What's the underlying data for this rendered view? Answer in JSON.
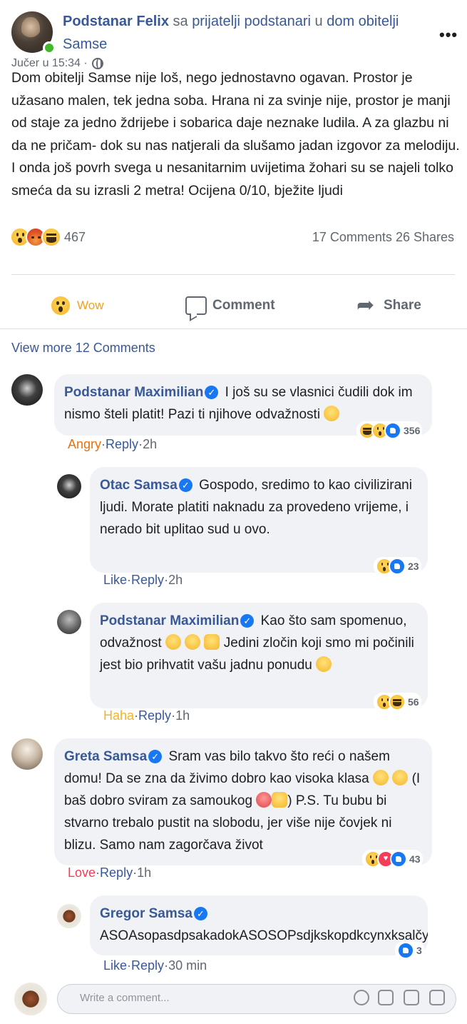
{
  "post": {
    "author": "Podstanar Felix",
    "with_text": "sa",
    "group": "prijatelji podstanari",
    "in_text": "u",
    "place": "dom obitelji Samse",
    "timestamp": "Jučer u 15:34 ·",
    "body": "Dom obitelji Samse nije loš, nego jednostavno ogavan. Prostor je užasano malen, tek jedna soba. Hrana ni za svinje nije, prostor je manji od staje za jedno ždrijebe i sobarica daje neznake ludila. A za glazbu ni da ne pričam- dok su nas natjerali da slušamo jadan izgovor za melodiju. I onda još povrh svega u nesanitarnim uvijetima žohari su se najeli tolko smeća da su izrasli 2 metra! Ocijena 0/10, bježite ljudi",
    "reaction_count": "467",
    "comments_count": "17 Comments",
    "shares_count": "26 Shares"
  },
  "actions": {
    "wow_label": "Wow",
    "comment_label": "Comment",
    "share_label": "Share"
  },
  "view_more": "View more 12 Comments",
  "comments": [
    {
      "name": "Podstanar Maximilian",
      "text": "I još su se vlasnici čudili dok im nismo šteli platit! Pazi ti njihove odvažnosti",
      "reaction": "Angry",
      "reply": "Reply",
      "time": "2h",
      "count": "356"
    },
    {
      "name": "Otac Samsa",
      "text": "Gospodo, sredimo to kao civilizirani ljudi. Morate platiti naknadu za provedeno vrijeme, i nerado bit uplitao sud u ovo.",
      "reaction": "Like",
      "reply": "Reply",
      "time": "2h",
      "count": "23"
    },
    {
      "name": "Podstanar Maximilian",
      "text": "Kao što sam spomenuo, odvažnost",
      "text2": "Jedini zločin koji smo mi počinili jest bio prihvatit vašu jadnu ponudu",
      "reaction": "Haha",
      "reply": "Reply",
      "time": "1h",
      "count": "56"
    },
    {
      "name": "Greta Samsa",
      "text": "Sram vas bilo takvo što reći o našem domu! Da se zna da živimo dobro kao visoka klasa",
      "text2": "(I baš dobro sviram za samoukog",
      "text3": ") P.S. Tu bubu bi stvarno trebalo pustit na slobodu, jer više nije čovjek ni blizu. Samo nam zagorčava život",
      "reaction": "Love",
      "reply": "Reply",
      "time": "1h",
      "count": "43"
    },
    {
      "name": "Gregor Samsa",
      "text": "ASOAsopasdpsakadokASOSOPsdjkskopdkcynxksalčy.n",
      "reaction": "Like",
      "reply": "Reply",
      "time": "30 min",
      "count": "3"
    }
  ],
  "write_comment": {
    "placeholder": "Write a comment..."
  },
  "verified_mark": "✓",
  "separator": "·"
}
